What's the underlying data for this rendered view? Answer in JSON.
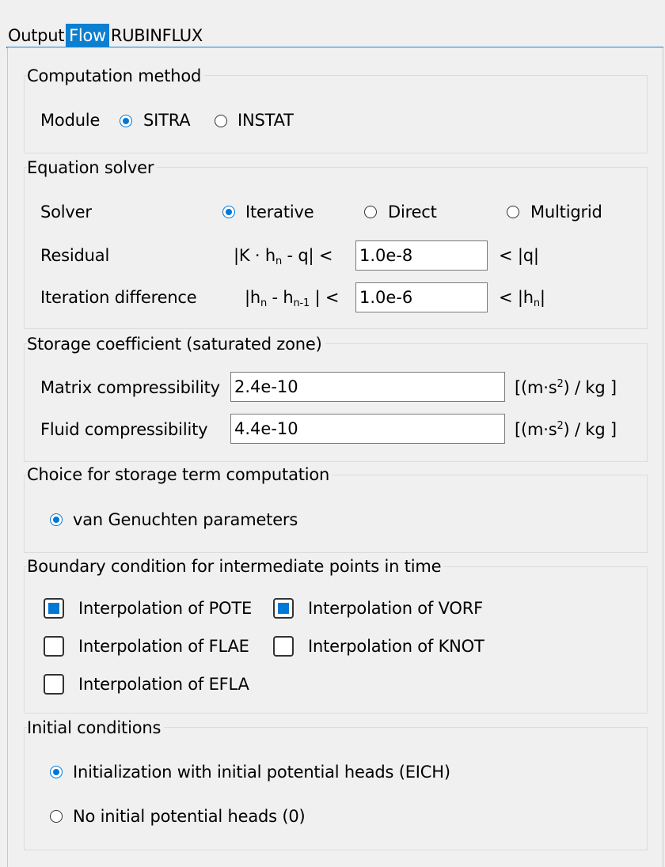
{
  "tabs": [
    {
      "label": "Output"
    },
    {
      "label": "Flow"
    },
    {
      "label": "RUBINFLUX"
    }
  ],
  "computation": {
    "title": "Computation method",
    "module_label": "Module",
    "opt_sitra": "SITRA",
    "opt_instat": "INSTAT",
    "selected": "SITRA"
  },
  "solver": {
    "title": "Equation solver",
    "solver_label": "Solver",
    "opt_iterative": "Iterative",
    "opt_direct": "Direct",
    "opt_multigrid": "Multigrid",
    "selected": "Iterative",
    "residual_label": "Residual",
    "residual_value": "1.0e-8",
    "iteration_label": "Iteration difference",
    "iteration_value": "1.0e-6"
  },
  "storage": {
    "title": "Storage coefficient (saturated zone)",
    "matrix_label": "Matrix compressibility",
    "matrix_value": "2.4e-10",
    "fluid_label": "Fluid compressibility",
    "fluid_value": "4.4e-10"
  },
  "storage_term": {
    "title": "Choice for storage term computation",
    "opt_vg": "van Genuchten parameters",
    "selected": "van Genuchten parameters"
  },
  "boundary": {
    "title": "Boundary condition for intermediate points in time",
    "pote": "Interpolation of POTE",
    "vorf": "Interpolation of VORF",
    "flae": "Interpolation of FLAE",
    "knot": "Interpolation of KNOT",
    "efla": "Interpolation of EFLA",
    "checked": [
      "POTE",
      "VORF"
    ]
  },
  "initial": {
    "title": "Initial conditions",
    "opt_eich": "Initialization with initial potential heads (EICH)",
    "opt_none": "No initial potential heads (0)",
    "selected": "EICH"
  },
  "colors": {
    "accent": "#0078d7",
    "tab_active": "#0c7fd0"
  }
}
